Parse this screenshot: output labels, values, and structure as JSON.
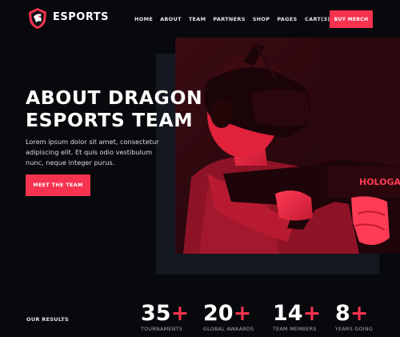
{
  "header": {
    "brand": "ESPORTS",
    "menu": [
      "HOME",
      "ABOUT",
      "TEAM",
      "PARTNERS",
      "SHOP",
      "PAGES"
    ],
    "cart": "CART(3)",
    "merch_button": "BUY MERCH"
  },
  "hero": {
    "title_line1": "ABOUT DRAGON",
    "title_line2": "ESPORTS TEAM",
    "description": "Lorem ipsum dolor sit amet, consectetur adipiscing elit. Et quis odio vestibulum nunc, neque integer purus.",
    "cta": "MEET THE TEAM",
    "gun_text": "HOLOGA"
  },
  "results": {
    "label": "OUR RESULTS",
    "stats": [
      {
        "value": "35",
        "suffix": "+",
        "label": "TOURNAMENTS"
      },
      {
        "value": "20",
        "suffix": "+",
        "label": "GLOBAL AWAARDS"
      },
      {
        "value": "14",
        "suffix": "+",
        "label": "TEAM MEMBERS"
      },
      {
        "value": "8",
        "suffix": "+",
        "label": "YEARS GOING"
      }
    ]
  },
  "colors": {
    "accent": "#f5334f",
    "background": "#07090d",
    "panel": "#141820"
  }
}
